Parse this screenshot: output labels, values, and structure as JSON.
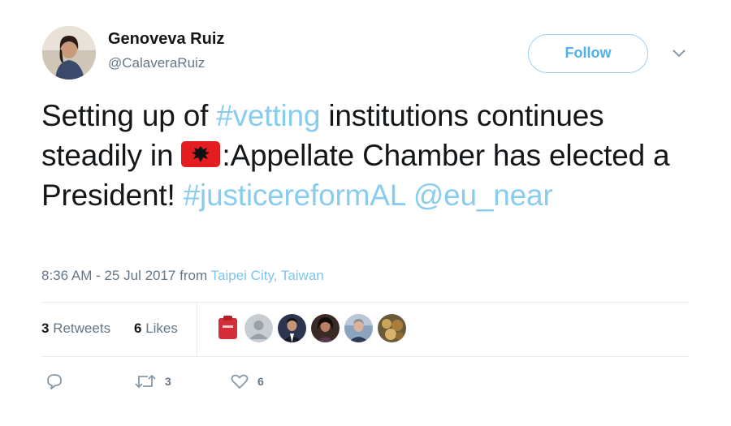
{
  "user": {
    "name": "Genoveva Ruiz",
    "handle": "@CalaveraRuiz"
  },
  "follow_label": "Follow",
  "tweet": {
    "t1": "Setting up of ",
    "tag1": "#vetting",
    "t2": " institutions continues steadily in ",
    "t3": ":Appellate Chamber has elected a President! ",
    "tag2": "#justicereformAL",
    "mention": "@eu_near"
  },
  "meta": {
    "time": "8:36 AM - 25 Jul 2017 from ",
    "location": "Taipei City, Taiwan"
  },
  "stats": {
    "retweets_count": "3",
    "retweets_label": "Retweets",
    "likes_count": "6",
    "likes_label": "Likes"
  },
  "actions": {
    "retweet_count": "3",
    "like_count": "6"
  },
  "icons": [
    "chevron-down-icon",
    "reply-icon",
    "retweet-icon",
    "heart-icon",
    "flag-albania-icon"
  ],
  "colors": {
    "link": "#88ccee",
    "follow_border": "#9bd2f7",
    "secondary_text": "#657786",
    "flag_red": "#e41e20"
  }
}
